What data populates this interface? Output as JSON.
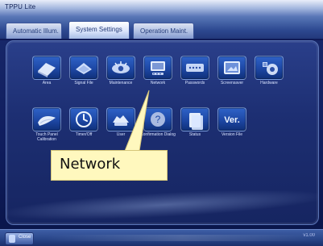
{
  "window": {
    "title": "TPPU Lite"
  },
  "tabs": [
    {
      "id": "automatic",
      "label": "Automatic Illum."
    },
    {
      "id": "system",
      "label": "System Settings"
    },
    {
      "id": "operation",
      "label": "Operation Maint."
    }
  ],
  "icons": [
    {
      "key": "area",
      "label": "Area",
      "icon": "area-icon"
    },
    {
      "key": "signal",
      "label": "Signal File",
      "icon": "signal-file-icon"
    },
    {
      "key": "maintenance",
      "label": "Maintenance",
      "icon": "maintenance-icon"
    },
    {
      "key": "network",
      "label": "Network",
      "icon": "network-icon"
    },
    {
      "key": "passwords",
      "label": "Passwords",
      "icon": "passwords-icon"
    },
    {
      "key": "screensaver",
      "label": "Screensaver",
      "icon": "screensaver-icon"
    },
    {
      "key": "hardware",
      "label": "Hardware",
      "icon": "hardware-icon"
    },
    {
      "key": "touch",
      "label": "Touch Panel Calibration",
      "icon": "touch-panel-icon"
    },
    {
      "key": "timer",
      "label": "Timer/Off",
      "icon": "timer-icon"
    },
    {
      "key": "user",
      "label": "User",
      "icon": "user-icon"
    },
    {
      "key": "confirmation",
      "label": "Confirmation Dialog",
      "icon": "help-icon"
    },
    {
      "key": "status",
      "label": "Status",
      "icon": "status-icon"
    },
    {
      "key": "version",
      "label": "Version File",
      "icon": "version-icon",
      "text": "Ver."
    }
  ],
  "callout": {
    "text": "Network"
  },
  "statusbar": {
    "close_label": "Close",
    "right_text": "v1.00"
  }
}
